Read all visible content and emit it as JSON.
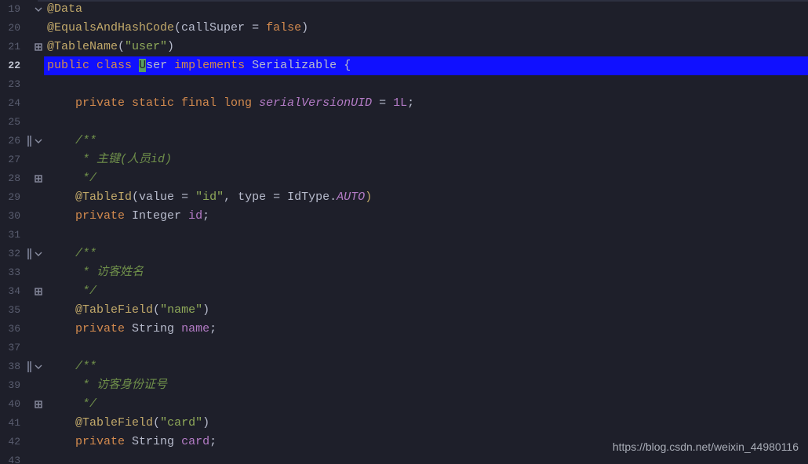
{
  "startLine": 19,
  "activeLine": 22,
  "watermark": "https://blog.csdn.net/weixin_44980116",
  "lines": {
    "l19": {
      "ann": "@Data"
    },
    "l20": {
      "ann": "@EqualsAndHashCode",
      "paren_open": "(",
      "param": "callSuper",
      "eq": " = ",
      "val": "false",
      "paren_close": ")"
    },
    "l21": {
      "ann": "@TableName",
      "paren_open": "(",
      "str": "\"user\"",
      "paren_close": ")"
    },
    "l22": {
      "kw1": "public",
      "sp1": " ",
      "kw2": "class",
      "sp2": " ",
      "cursor": "U",
      "classname": "ser",
      "sp3": " ",
      "kw3": "implements",
      "sp4": " ",
      "iface": "Serializable",
      "sp5": " ",
      "brace": "{"
    },
    "l24": {
      "mods": "private static final long",
      "sp": " ",
      "field": "serialVersionUID",
      "rest": " = ",
      "num": "1L",
      "semi": ";"
    },
    "l26": {
      "c": "/**"
    },
    "l27": {
      "c": " * 主键(人员id)"
    },
    "l28": {
      "c": " */"
    },
    "l29": {
      "ann": "@TableId",
      "open": "(",
      "p1": "value",
      "eq1": " = ",
      "s1": "\"id\"",
      "comma": ", ",
      "p2": "type",
      "eq2": " = ",
      "cls": "IdType",
      "dot": ".",
      "enum": "AUTO",
      "close": ")"
    },
    "l30": {
      "kw": "private",
      "sp": " ",
      "type": "Integer",
      "sp2": " ",
      "name": "id",
      "semi": ";"
    },
    "l32": {
      "c": "/**"
    },
    "l33": {
      "c": " * 访客姓名"
    },
    "l34": {
      "c": " */"
    },
    "l35": {
      "ann": "@TableField",
      "open": "(",
      "str": "\"name\"",
      "close": ")"
    },
    "l36": {
      "kw": "private",
      "sp": " ",
      "type": "String",
      "sp2": " ",
      "name": "name",
      "semi": ";"
    },
    "l38": {
      "c": "/**"
    },
    "l39": {
      "c": " * 访客身份证号"
    },
    "l40": {
      "c": " */"
    },
    "l41": {
      "ann": "@TableField",
      "open": "(",
      "str": "\"card\"",
      "close": ")"
    },
    "l42": {
      "kw": "private",
      "sp": " ",
      "type": "String",
      "sp2": " ",
      "name": "card",
      "semi": ";"
    }
  }
}
